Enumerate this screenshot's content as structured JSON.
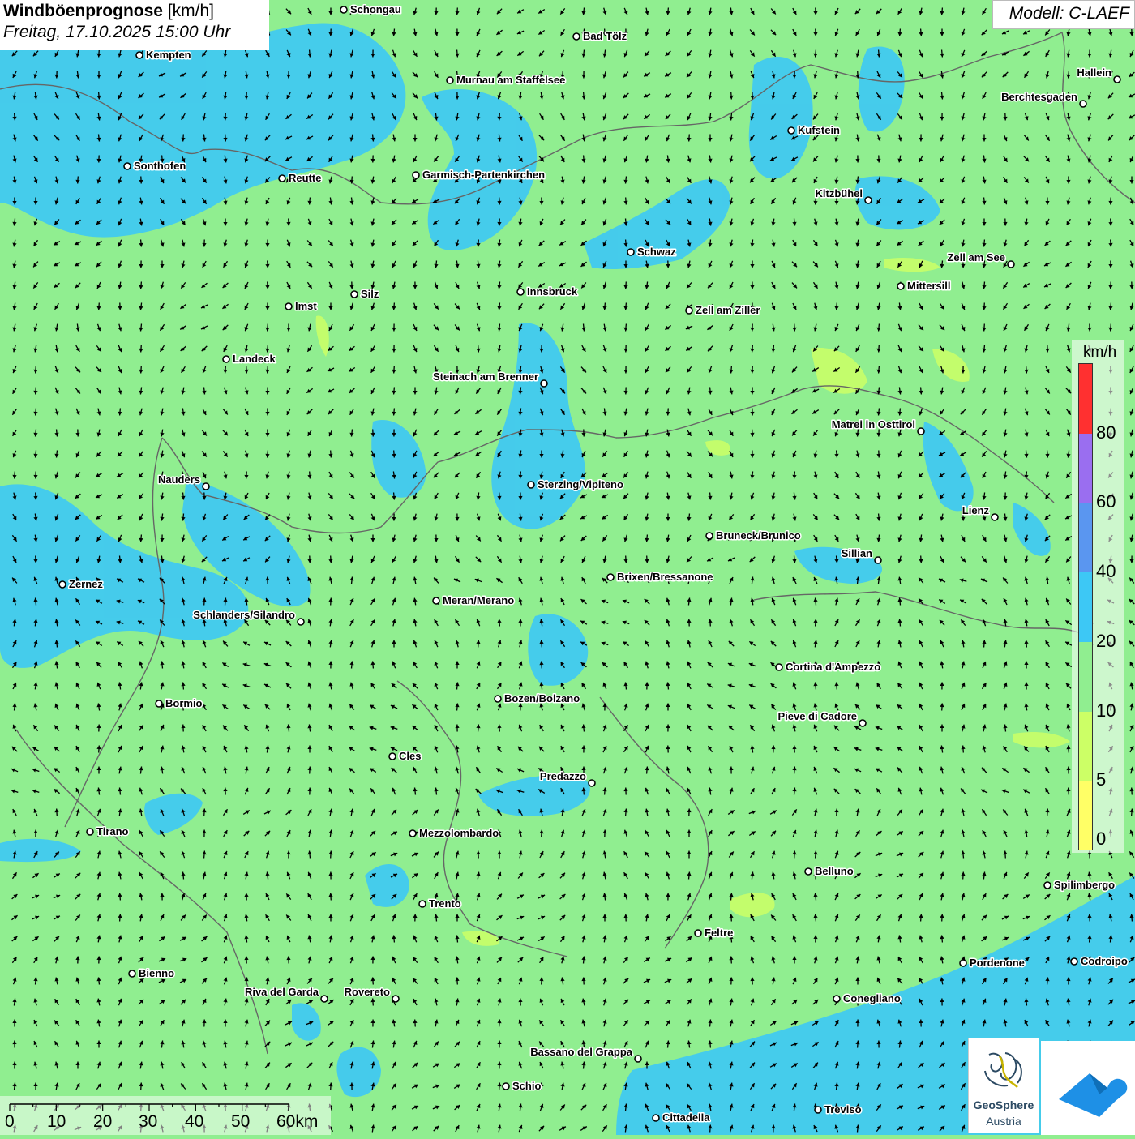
{
  "header": {
    "title_bold": "Windböenprognose",
    "title_unit": "[km/h]",
    "subtitle": "Freitag, 17.10.2025 15:00 Uhr",
    "model": "Modell: C-LAEF"
  },
  "legend": {
    "unit": "km/h",
    "ticks": [
      "0",
      "5",
      "10",
      "20",
      "40",
      "60",
      "80"
    ],
    "colors": [
      "#ffff66",
      "#ccff66",
      "#90ee90",
      "#3dc8f5",
      "#5a96f0",
      "#9a6ef0",
      "#ff3030"
    ]
  },
  "scalebar": {
    "labels": [
      "0",
      "10",
      "20",
      "30",
      "40",
      "50",
      "60km"
    ]
  },
  "logos": {
    "geosphere_line1": "GeoSphere",
    "geosphere_line2": "Austria"
  },
  "colors": {
    "land": "#90ee90",
    "wind_20": "#3dc8f5",
    "wind_5": "#ccff66",
    "border": "#666666",
    "arrow": "#000000"
  },
  "cities": [
    {
      "name": "Schongau"
    },
    {
      "name": "Bad Tölz"
    },
    {
      "name": "Kempten"
    },
    {
      "name": "Hallein"
    },
    {
      "name": "Murnau am Staffelsee"
    },
    {
      "name": "Berchtesgaden"
    },
    {
      "name": "Kufstein"
    },
    {
      "name": "Sonthofen"
    },
    {
      "name": "Reutte"
    },
    {
      "name": "Garmisch-Partenkirchen"
    },
    {
      "name": "Kitzbühel"
    },
    {
      "name": "Schwaz"
    },
    {
      "name": "Zell am See"
    },
    {
      "name": "Mittersill"
    },
    {
      "name": "Innsbruck"
    },
    {
      "name": "Silz"
    },
    {
      "name": "Imst"
    },
    {
      "name": "Zell am Ziller"
    },
    {
      "name": "Landeck"
    },
    {
      "name": "Steinach am Brenner"
    },
    {
      "name": "Matrei in Osttirol"
    },
    {
      "name": "Nauders"
    },
    {
      "name": "Sterzing/Vipiteno"
    },
    {
      "name": "Lienz"
    },
    {
      "name": "Bruneck/Brunico"
    },
    {
      "name": "Sillian"
    },
    {
      "name": "Zernez"
    },
    {
      "name": "Brixen/Bressanone"
    },
    {
      "name": "Meran/Merano"
    },
    {
      "name": "Schlanders/Silandro"
    },
    {
      "name": "Cortina d'Ampezzo"
    },
    {
      "name": "Bozen/Bolzano"
    },
    {
      "name": "Bormio"
    },
    {
      "name": "Pieve di Cadore"
    },
    {
      "name": "Cles"
    },
    {
      "name": "Predazzo"
    },
    {
      "name": "Tirano"
    },
    {
      "name": "Mezzolombardo"
    },
    {
      "name": "Belluno"
    },
    {
      "name": "Spilimbergo"
    },
    {
      "name": "Trento"
    },
    {
      "name": "Feltre"
    },
    {
      "name": "Pordenone"
    },
    {
      "name": "Codroipo"
    },
    {
      "name": "Bienno"
    },
    {
      "name": "Riva del Garda"
    },
    {
      "name": "Rovereto"
    },
    {
      "name": "Conegliano"
    },
    {
      "name": "Bassano del Grappa"
    },
    {
      "name": "Schio"
    },
    {
      "name": "Treviso"
    },
    {
      "name": "Cittadella"
    }
  ]
}
